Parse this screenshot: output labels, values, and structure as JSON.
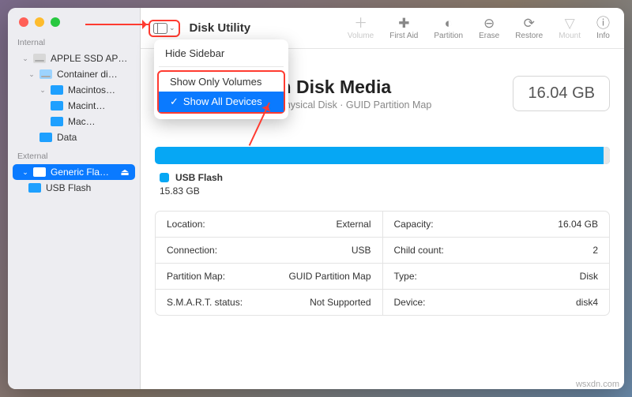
{
  "app": {
    "title": "Disk Utility"
  },
  "toolbar": {
    "volume": "Volume",
    "firstaid": "First Aid",
    "partition": "Partition",
    "erase": "Erase",
    "restore": "Restore",
    "mount": "Mount",
    "info": "Info"
  },
  "menu": {
    "hide_sidebar": "Hide Sidebar",
    "show_only_volumes": "Show Only Volumes",
    "show_all_devices": "Show All Devices"
  },
  "sidebar": {
    "internal_label": "Internal",
    "external_label": "External",
    "internal": [
      {
        "label": "APPLE SSD AP…"
      },
      {
        "label": "Container di…"
      },
      {
        "label": "Macintos…"
      },
      {
        "label": "Macint…"
      },
      {
        "label": "Mac…"
      },
      {
        "label": "Data"
      }
    ],
    "external": [
      {
        "label": "Generic Fla…"
      },
      {
        "label": "USB Flash"
      }
    ]
  },
  "header": {
    "title": "ric Flash Disk Media",
    "subtitle": "USB External Physical Disk · GUID Partition Map",
    "capacity": "16.04 GB"
  },
  "legend": {
    "name": "USB Flash",
    "size": "15.83 GB"
  },
  "info": {
    "rows": [
      {
        "lk": "Location:",
        "lv": "External",
        "rk": "Capacity:",
        "rv": "16.04 GB"
      },
      {
        "lk": "Connection:",
        "lv": "USB",
        "rk": "Child count:",
        "rv": "2"
      },
      {
        "lk": "Partition Map:",
        "lv": "GUID Partition Map",
        "rk": "Type:",
        "rv": "Disk"
      },
      {
        "lk": "S.M.A.R.T. status:",
        "lv": "Not Supported",
        "rk": "Device:",
        "rv": "disk4"
      }
    ]
  },
  "watermark": "wsxdn.com"
}
